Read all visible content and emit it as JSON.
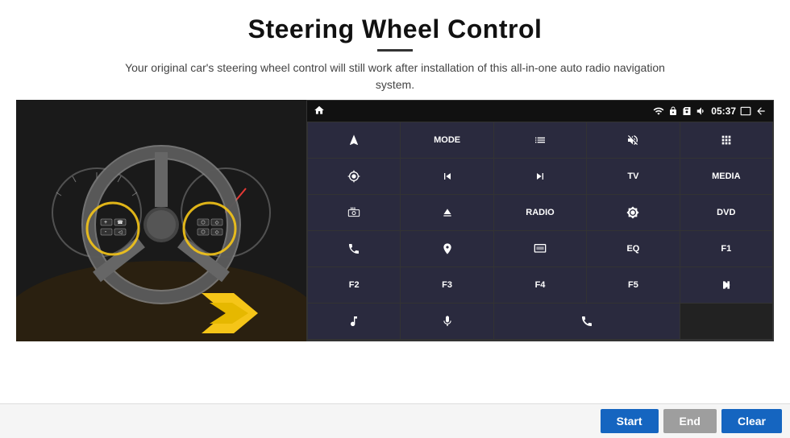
{
  "header": {
    "title": "Steering Wheel Control",
    "subtitle": "Your original car's steering wheel control will still work after installation of this all-in-one auto radio navigation system."
  },
  "status_bar": {
    "time": "05:37",
    "icons": [
      "wifi",
      "lock",
      "sim",
      "volume",
      "screen",
      "back"
    ]
  },
  "grid_buttons": [
    {
      "label": "nav",
      "type": "icon",
      "row": 1,
      "col": 1
    },
    {
      "label": "MODE",
      "type": "text",
      "row": 1,
      "col": 2
    },
    {
      "label": "list",
      "type": "icon",
      "row": 1,
      "col": 3
    },
    {
      "label": "mute",
      "type": "icon",
      "row": 1,
      "col": 4
    },
    {
      "label": "apps",
      "type": "icon",
      "row": 1,
      "col": 5
    },
    {
      "label": "settings",
      "type": "icon",
      "row": 2,
      "col": 1
    },
    {
      "label": "prev",
      "type": "icon",
      "row": 2,
      "col": 2
    },
    {
      "label": "next",
      "type": "icon",
      "row": 2,
      "col": 3
    },
    {
      "label": "TV",
      "type": "text",
      "row": 2,
      "col": 4
    },
    {
      "label": "MEDIA",
      "type": "text",
      "row": 2,
      "col": 5
    },
    {
      "label": "360cam",
      "type": "icon",
      "row": 3,
      "col": 1
    },
    {
      "label": "eject",
      "type": "icon",
      "row": 3,
      "col": 2
    },
    {
      "label": "RADIO",
      "type": "text",
      "row": 3,
      "col": 3
    },
    {
      "label": "brightness",
      "type": "icon",
      "row": 3,
      "col": 4
    },
    {
      "label": "DVD",
      "type": "text",
      "row": 3,
      "col": 5
    },
    {
      "label": "phone",
      "type": "icon",
      "row": 4,
      "col": 1
    },
    {
      "label": "gps",
      "type": "icon",
      "row": 4,
      "col": 2
    },
    {
      "label": "dash",
      "type": "icon",
      "row": 4,
      "col": 3
    },
    {
      "label": "EQ",
      "type": "text",
      "row": 4,
      "col": 4
    },
    {
      "label": "F1",
      "type": "text",
      "row": 4,
      "col": 5
    },
    {
      "label": "F2",
      "type": "text",
      "row": 5,
      "col": 1
    },
    {
      "label": "F3",
      "type": "text",
      "row": 5,
      "col": 2
    },
    {
      "label": "F4",
      "type": "text",
      "row": 5,
      "col": 3
    },
    {
      "label": "F5",
      "type": "text",
      "row": 5,
      "col": 4
    },
    {
      "label": "playpause",
      "type": "icon",
      "row": 5,
      "col": 5
    },
    {
      "label": "music",
      "type": "icon",
      "row": 6,
      "col": 1
    },
    {
      "label": "mic",
      "type": "icon",
      "row": 6,
      "col": 2
    },
    {
      "label": "hangup",
      "type": "icon",
      "row": 6,
      "col": 3,
      "span": 1
    }
  ],
  "bottom_buttons": {
    "start": "Start",
    "end": "End",
    "clear": "Clear"
  }
}
